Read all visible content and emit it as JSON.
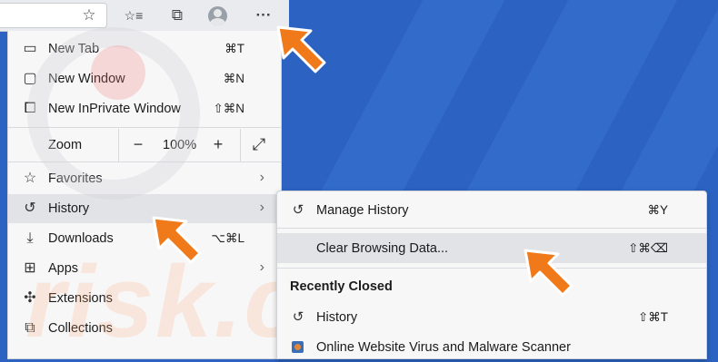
{
  "colors": {
    "background": "#2c63c2",
    "menu_bg": "#f7f7f8",
    "highlight": "#e2e3e6",
    "arrow": "#f07a1a"
  },
  "toolbar": {
    "icons": [
      "star-icon",
      "favorites-list-icon",
      "collections-icon",
      "profile-avatar",
      "more-menu-icon"
    ],
    "star": "☆",
    "favorites": "☆≡",
    "collections": "⧉",
    "more": "···"
  },
  "menu": {
    "new_tab": {
      "label": "New Tab",
      "shortcut": "⌘T"
    },
    "new_window": {
      "label": "New Window",
      "shortcut": "⌘N"
    },
    "new_inprivate": {
      "label": "New InPrivate Window",
      "shortcut": "⇧⌘N"
    },
    "zoom": {
      "label": "Zoom",
      "minus": "−",
      "value": "100%",
      "plus": "+",
      "fullscreen": "⤢"
    },
    "favorites": {
      "label": "Favorites"
    },
    "history": {
      "label": "History"
    },
    "downloads": {
      "label": "Downloads",
      "shortcut": "⌥⌘L"
    },
    "apps": {
      "label": "Apps"
    },
    "extensions": {
      "label": "Extensions"
    },
    "collections": {
      "label": "Collections"
    }
  },
  "history_submenu": {
    "manage_history": {
      "label": "Manage History",
      "shortcut": "⌘Y"
    },
    "clear_browsing_data": {
      "label": "Clear Browsing Data...",
      "shortcut": "⇧⌘⌫"
    },
    "recently_closed_heading": "Recently Closed",
    "history_item": {
      "label": "History",
      "shortcut": "⇧⌘T"
    },
    "closed_page": {
      "label": "Online Website Virus and Malware Scanner"
    }
  },
  "watermark": {
    "text": "risk.com"
  }
}
